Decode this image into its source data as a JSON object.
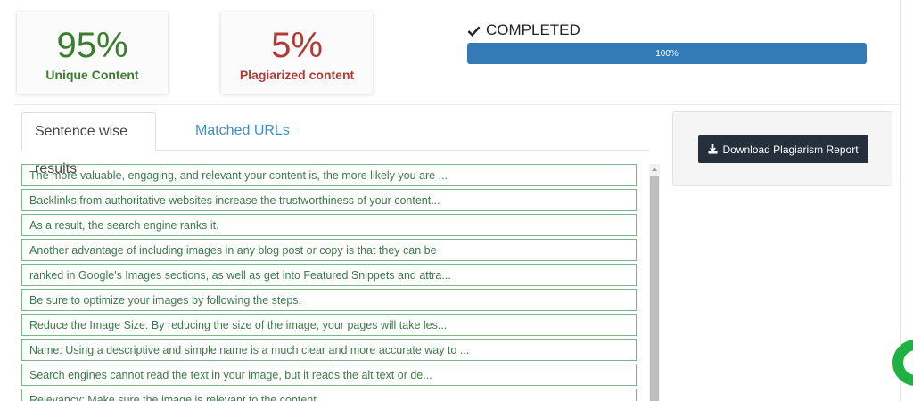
{
  "stats": {
    "unique": {
      "value": "95%",
      "label": "Unique Content",
      "color": "#3a7d2c"
    },
    "plagiarized": {
      "value": "5%",
      "label": "Plagiarized content",
      "color": "#b13a36"
    }
  },
  "status": {
    "icon": "check-icon",
    "text": "COMPLETED"
  },
  "progress": {
    "percent": 100,
    "label": "100%",
    "color": "#337ab7"
  },
  "tabs": [
    {
      "label": "Sentence wise results",
      "active": true
    },
    {
      "label": "Matched URLs",
      "active": false
    }
  ],
  "results": [
    "The more valuable, engaging, and relevant your content is, the more likely you are ...",
    "Backlinks from authoritative websites increase the trustworthiness of your content...",
    "As a result, the search engine ranks it.",
    "Another advantage of including images in any blog post or copy is that they can be",
    "ranked in Google's Images sections, as well as get into Featured Snippets and attra...",
    "Be sure to optimize your images by following the steps.",
    "Reduce the Image Size: By reducing the size of the image, your pages will take les...",
    "Name: Using a descriptive and simple name is a much clear and more accurate way to ...",
    "Search engines cannot read the text in your image, but it reads the alt text or de...",
    "Relevancy: Make sure the image is relevant to the content."
  ],
  "report": {
    "button_label": "Download Plagiarism Report",
    "icon": "download-icon"
  },
  "chat": {
    "icon": "chat-icon",
    "color": "#1fb141"
  }
}
